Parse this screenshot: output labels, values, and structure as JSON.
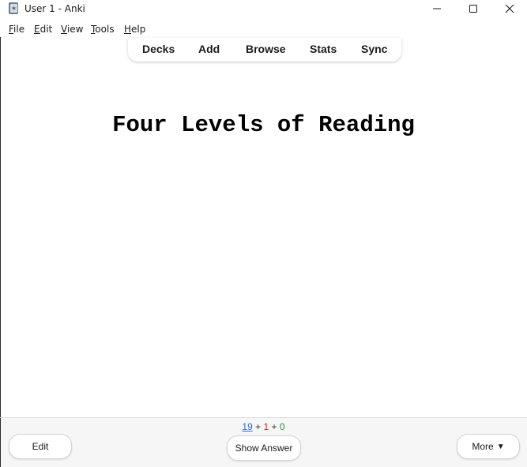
{
  "window": {
    "title": "User 1 - Anki"
  },
  "menu": {
    "items": [
      {
        "mnemonic": "F",
        "rest": "ile"
      },
      {
        "mnemonic": "E",
        "rest": "dit"
      },
      {
        "mnemonic": "V",
        "rest": "iew"
      },
      {
        "mnemonic": "T",
        "rest": "ools"
      },
      {
        "mnemonic": "H",
        "rest": "elp"
      }
    ]
  },
  "toolbar": {
    "decks": "Decks",
    "add": "Add",
    "browse": "Browse",
    "stats": "Stats",
    "sync": "Sync"
  },
  "card": {
    "front_text": "Four Levels of Reading"
  },
  "counts": {
    "new": "19",
    "learning": "1",
    "review": "0",
    "separator": "+"
  },
  "buttons": {
    "edit": "Edit",
    "show_answer": "Show Answer",
    "more": "More",
    "more_caret": "▼"
  },
  "colors": {
    "new_count": "#2f6ad8",
    "learning_count": "#c62828",
    "review_count": "#2e8b3a"
  },
  "icons": {
    "app": "anki-app-icon",
    "minimize": "minimize-icon",
    "maximize": "maximize-icon",
    "close": "close-icon"
  }
}
